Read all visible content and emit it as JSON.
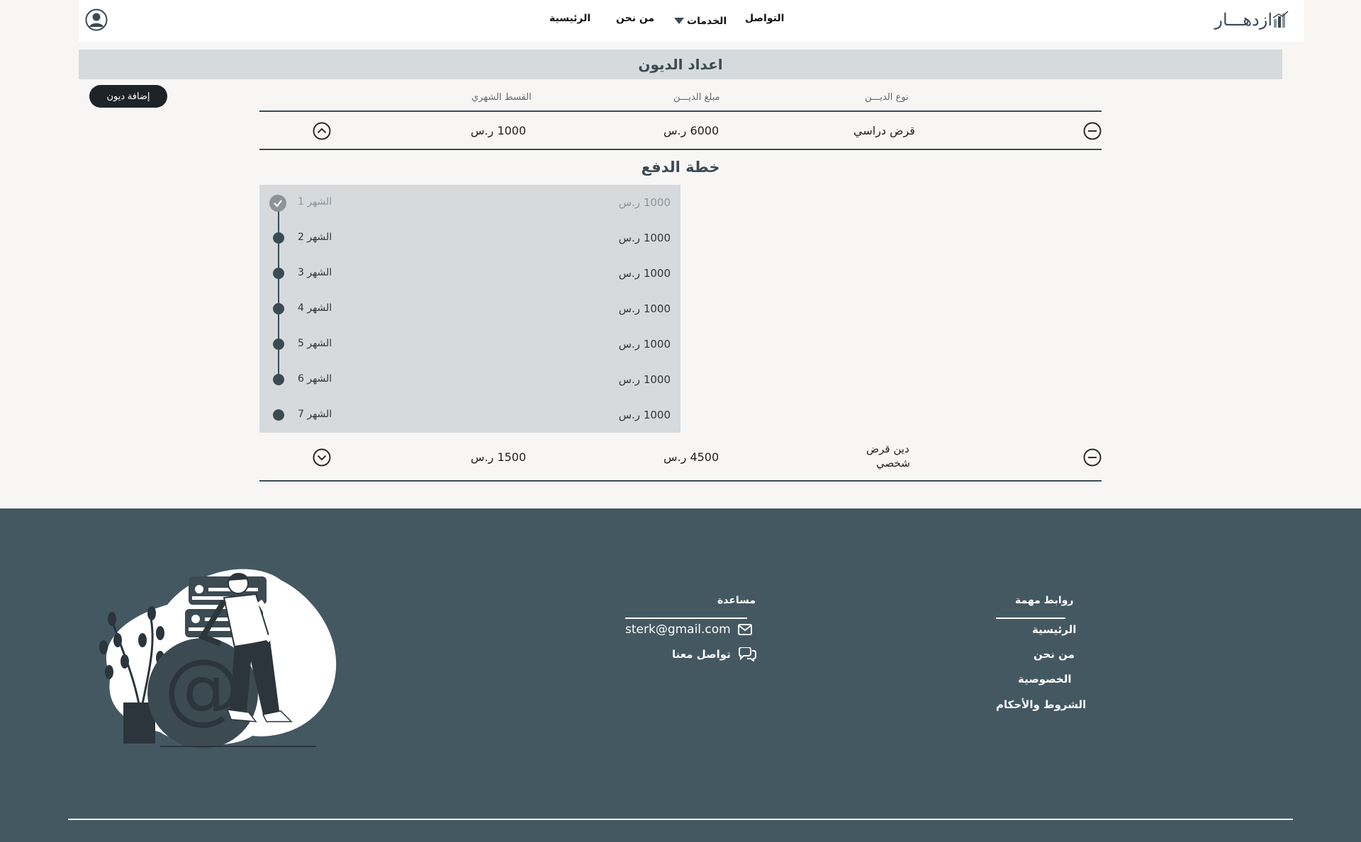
{
  "header": {
    "logo_text": "ازدهـــار",
    "nav": {
      "home": "الرئيسية",
      "about": "من نحن",
      "services": "الخدمات",
      "contact": "التواصل"
    }
  },
  "page": {
    "title": "اعداد الديون",
    "add_button": "إضافة ديون"
  },
  "table": {
    "headers": {
      "type": "نوع الديـــن",
      "amount": "مبلغ الديـــن",
      "monthly": "القسط الشهري"
    },
    "rows": [
      {
        "type": "قرض دراسي",
        "type_line2": "",
        "amount": "6000 ر.س",
        "monthly": "1000 ر.س",
        "expanded": true
      },
      {
        "type": "دين قرض",
        "type_line2": "شخصي",
        "amount": "4500 ر.س",
        "monthly": "1500 ر.س",
        "expanded": false
      }
    ]
  },
  "payment_plan": {
    "title": "خطة الدفع",
    "months": [
      {
        "month": "الشهر 1",
        "amount": "1000 ر.س",
        "paid": true
      },
      {
        "month": "الشهر 2",
        "amount": "1000 ر.س",
        "paid": false
      },
      {
        "month": "الشهر 3",
        "amount": "1000 ر.س",
        "paid": false
      },
      {
        "month": "الشهر 4",
        "amount": "1000 ر.س",
        "paid": false
      },
      {
        "month": "الشهر 5",
        "amount": "1000 ر.س",
        "paid": false
      },
      {
        "month": "الشهر 6",
        "amount": "1000 ر.س",
        "paid": false
      },
      {
        "month": "الشهر 7",
        "amount": "1000 ر.س",
        "paid": false
      }
    ]
  },
  "footer": {
    "links_title": "روابط مهمة",
    "links": [
      "الرئيسية",
      "من نحن",
      "الخصوصية",
      "الشروط والأحكام"
    ],
    "help_title": "مساعدة",
    "email": "sterk@gmail.com",
    "contact_us": "تواصل معنا"
  },
  "colors": {
    "primary": "#3c4a52",
    "footer_bg": "#445862",
    "panel_bg": "#d6dadd",
    "page_bg": "#f7f6f5"
  }
}
